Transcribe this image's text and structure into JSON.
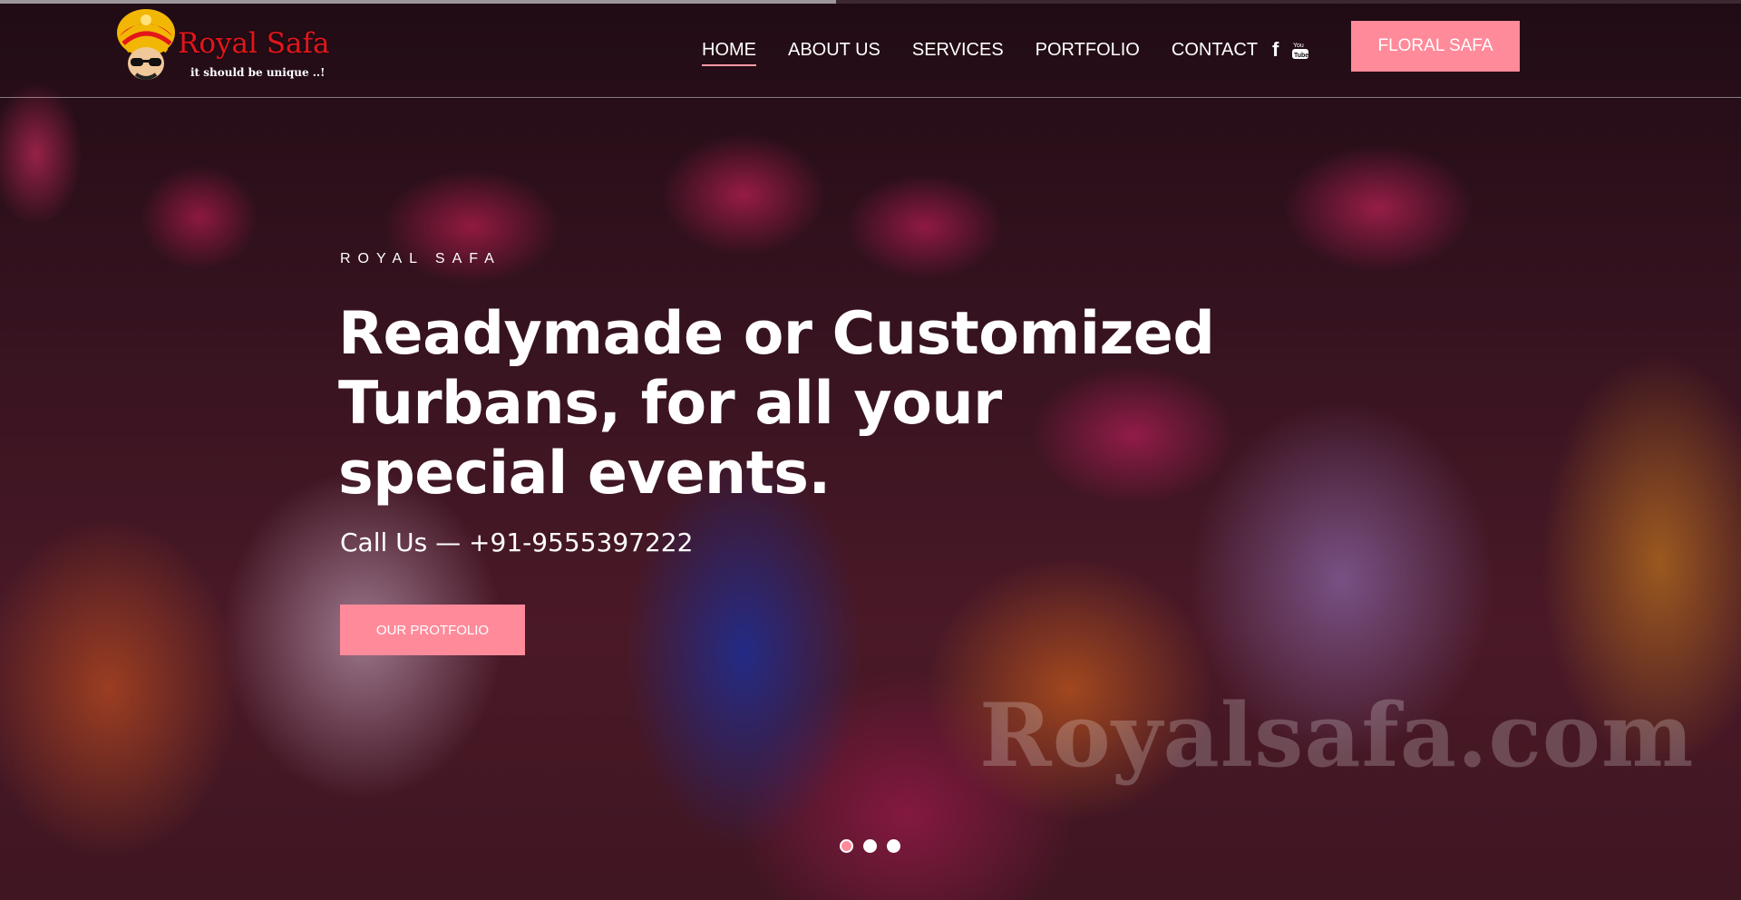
{
  "header": {
    "loader_progress": 0.48,
    "logo": {
      "title": "Royal Safa",
      "tagline": "it should be unique ..!"
    },
    "nav": [
      {
        "label": "HOME",
        "active": true
      },
      {
        "label": "ABOUT US",
        "active": false
      },
      {
        "label": "SERVICES",
        "active": false
      },
      {
        "label": "PORTFOLIO",
        "active": false
      },
      {
        "label": "CONTACT",
        "active": false
      }
    ],
    "social": {
      "facebook_glyph": "f",
      "facebook_icon": "facebook-icon",
      "youtube_icon": "youtube-icon"
    },
    "cta_label": "FLORAL SAFA"
  },
  "hero": {
    "eyebrow": "ROYAL SAFA",
    "headline": "Readymade or Customized Turbans, for all your special events.",
    "phone": "Call Us — +91-9555397222",
    "cta_label": "OUR PROTFOLIO",
    "watermark": "Royalsafa.com"
  },
  "slider": {
    "count": 3,
    "active_index": 0
  },
  "colors": {
    "accent": "#ff8a9a",
    "logo_red": "#e3161b",
    "overlay": "#0f060a"
  }
}
